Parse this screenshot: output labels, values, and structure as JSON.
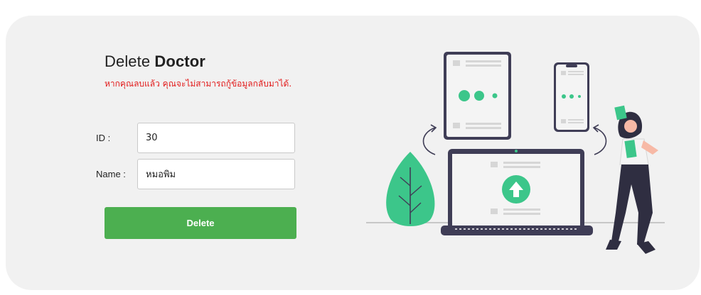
{
  "form": {
    "title_prefix": "Delete",
    "title_bold": "Doctor",
    "warning": "หากคุณลบแล้ว คุณจะไม่สามารถกู้ข้อมูลกลับมาได้.",
    "id_label": "ID :",
    "id_value": "30",
    "name_label": "Name :",
    "name_value": "หมอพิม",
    "delete_label": "Delete"
  },
  "colors": {
    "button": "#4caf50",
    "warning": "#e21b1b",
    "accent_green": "#3cc68a",
    "device_dark": "#3f3d56"
  },
  "illustration": {
    "icons": [
      "tablet",
      "phone",
      "laptop",
      "upload-arrow",
      "plant",
      "woman-with-paper"
    ]
  }
}
